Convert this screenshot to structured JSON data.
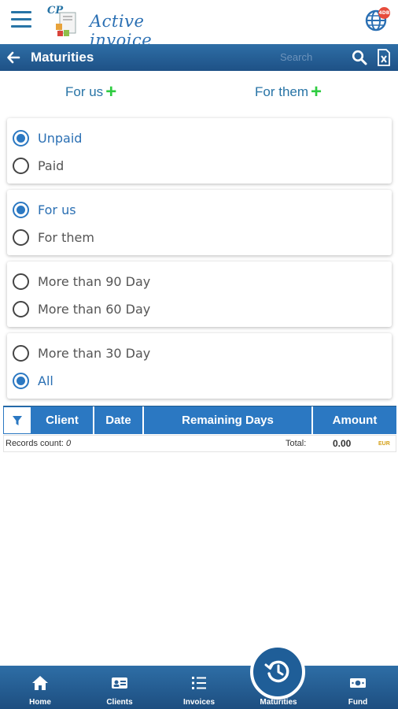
{
  "app": {
    "logo_mark": "CP",
    "name": "Active invoice",
    "notification_badge": "4DB"
  },
  "titlebar": {
    "title": "Maturities",
    "search_placeholder": "Search"
  },
  "quick_add": {
    "for_us": "For us",
    "for_them": "For them"
  },
  "filters": {
    "payment": [
      {
        "label": "Unpaid",
        "selected": true
      },
      {
        "label": "Paid",
        "selected": false
      }
    ],
    "side": [
      {
        "label": "For us",
        "selected": true
      },
      {
        "label": "For them",
        "selected": false
      }
    ],
    "age_a": [
      {
        "label": "More than 90 Day",
        "selected": false
      },
      {
        "label": "More than 60 Day",
        "selected": false
      }
    ],
    "age_b": [
      {
        "label": "More than 30 Day",
        "selected": false
      },
      {
        "label": "All",
        "selected": true
      }
    ]
  },
  "table": {
    "columns": [
      "Client",
      "Date",
      "Remaining Days",
      "Amount"
    ],
    "rows": [],
    "records_label": "Records count:",
    "records_count": "0",
    "total_label": "Total:",
    "total_value": "0.00",
    "currency": "EUR"
  },
  "nav": {
    "items": [
      {
        "label": "Home",
        "icon": "home-icon"
      },
      {
        "label": "Clients",
        "icon": "id-card-icon"
      },
      {
        "label": "Invoices",
        "icon": "list-icon"
      },
      {
        "label": "Maturities",
        "icon": "history-icon",
        "active": true
      },
      {
        "label": "Fund",
        "icon": "cash-icon"
      }
    ]
  },
  "colors": {
    "primary": "#2b78c2",
    "bar": "#1e5186",
    "plus": "#2ecc40",
    "badge": "#e74c3c"
  }
}
